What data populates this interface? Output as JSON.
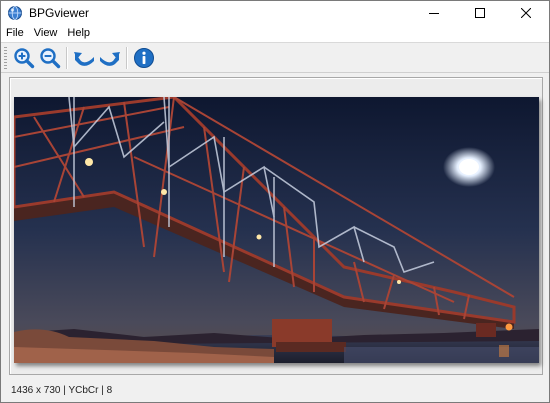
{
  "window": {
    "title": "BPGviewer",
    "app_icon": "bpg-globe-icon",
    "controls": {
      "minimize": "minimize-icon",
      "maximize": "maximize-icon",
      "close": "close-icon"
    }
  },
  "menu": {
    "items": [
      {
        "label": "File"
      },
      {
        "label": "View"
      },
      {
        "label": "Help"
      }
    ]
  },
  "toolbar": {
    "buttons": [
      {
        "icon": "zoom-in-icon"
      },
      {
        "icon": "zoom-out-icon"
      },
      {
        "icon": "rotate-left-icon"
      },
      {
        "icon": "rotate-right-icon"
      },
      {
        "icon": "info-icon"
      }
    ]
  },
  "image": {
    "subject": "bridge-photo"
  },
  "status": {
    "text": "1436 x 730 | YCbCr | 8"
  },
  "colors": {
    "accent_blue": "#1f6fc4",
    "window_bg": "#f0f0f0"
  }
}
